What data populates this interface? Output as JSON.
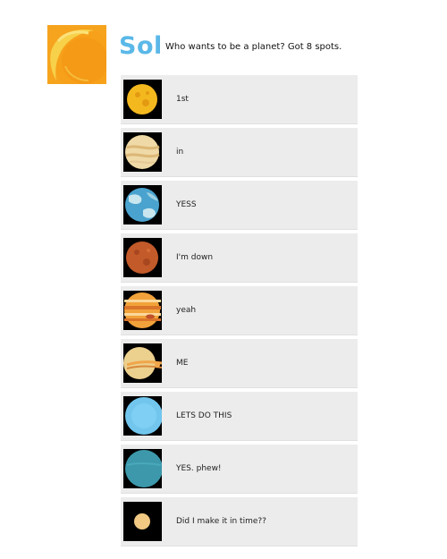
{
  "post": {
    "author": "Sol",
    "status": "Who wants to be a planet? Got 8 spots.",
    "avatar_icon": "sun-icon"
  },
  "replies": [
    {
      "text": "1st",
      "planet_icon": "mercury-icon"
    },
    {
      "text": "in",
      "planet_icon": "venus-icon"
    },
    {
      "text": "YESS",
      "planet_icon": "earth-icon"
    },
    {
      "text": "I'm down",
      "planet_icon": "mars-icon"
    },
    {
      "text": "yeah",
      "planet_icon": "jupiter-icon"
    },
    {
      "text": "ME",
      "planet_icon": "saturn-icon"
    },
    {
      "text": "LETS DO THIS",
      "planet_icon": "uranus-icon"
    },
    {
      "text": "YES. phew!",
      "planet_icon": "neptune-icon"
    },
    {
      "text": "Did I make it in time??",
      "planet_icon": "pluto-icon"
    }
  ],
  "colors": {
    "name_blue": "#5ab8e8",
    "row_bg": "#ececec",
    "sun_orange": "#f29d1a"
  }
}
